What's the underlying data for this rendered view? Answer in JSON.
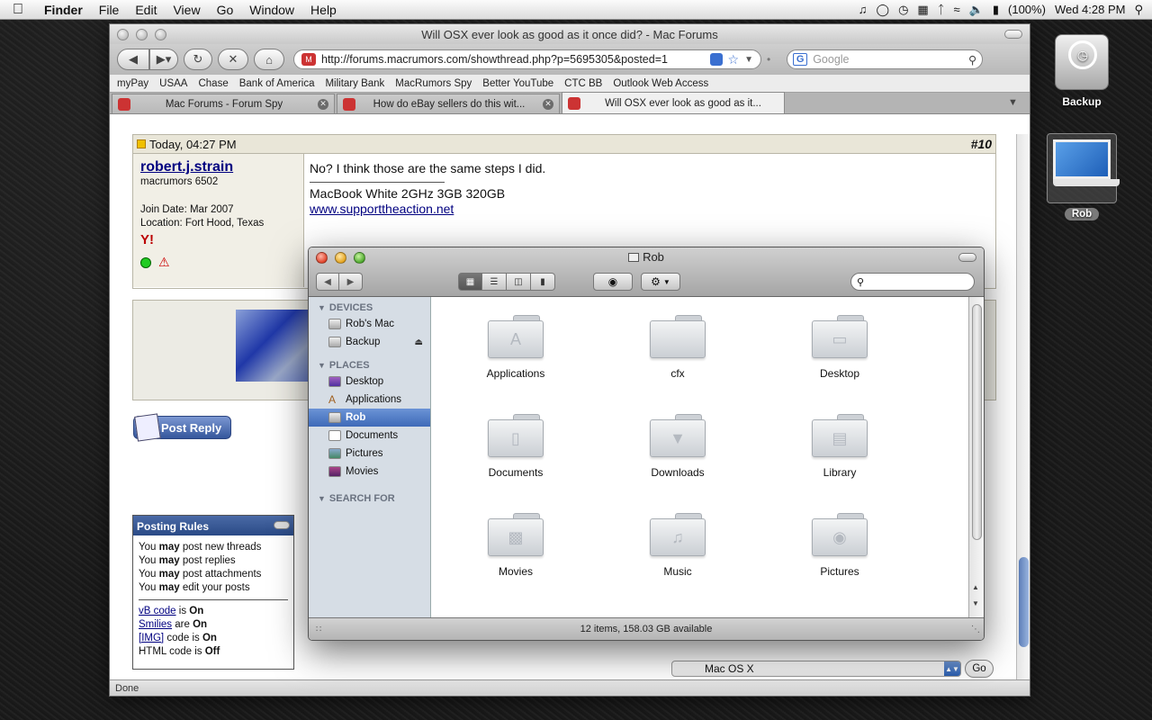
{
  "menubar": {
    "app": "Finder",
    "menus": [
      "File",
      "Edit",
      "View",
      "Go",
      "Window",
      "Help"
    ],
    "battery": "(100%)",
    "clock": "Wed 4:28 PM"
  },
  "browser": {
    "title": "Will OSX ever look as good as it once did? - Mac Forums",
    "url": "http://forums.macrumors.com/showthread.php?p=5695305&posted=1",
    "search_placeholder": "Google",
    "bookmarks": [
      "myPay",
      "USAA",
      "Chase",
      "Bank of America",
      "Military Bank",
      "MacRumors Spy",
      "Better YouTube",
      "CTC BB",
      "Outlook Web Access"
    ],
    "tabs": [
      {
        "label": "Mac Forums - Forum Spy"
      },
      {
        "label": "How do eBay sellers do this wit..."
      },
      {
        "label": "Will OSX ever look as good as it..."
      }
    ],
    "status": "Done"
  },
  "post": {
    "date": "Today, 04:27 PM",
    "number": "#10",
    "username": "robert.j.strain",
    "rank": "macrumors 6502",
    "join_date": "Join Date: Mar 2007",
    "location": "Location: Fort Hood, Texas",
    "message": "No? I think those are the same steps I did.",
    "signature": "MacBook White 2GHz 3GB 320GB",
    "link": "www.supporttheaction.net",
    "reply_button": "Post Reply"
  },
  "rules": {
    "title": "Posting Rules",
    "lines": [
      {
        "pre": "You ",
        "b": "may",
        "post": " post new threads"
      },
      {
        "pre": "You ",
        "b": "may",
        "post": " post replies"
      },
      {
        "pre": "You ",
        "b": "may",
        "post": " post attachments"
      },
      {
        "pre": "You ",
        "b": "may",
        "post": " edit your posts"
      }
    ],
    "codes": [
      {
        "link": "vB code",
        "mid": " is ",
        "b": "On"
      },
      {
        "link": "Smilies",
        "mid": " are ",
        "b": "On"
      },
      {
        "link": "[IMG]",
        "mid": " code is ",
        "b": "On"
      },
      {
        "link": "",
        "mid": "HTML code is ",
        "b": "Off"
      }
    ]
  },
  "forum_jump": {
    "selected": "Mac OS X",
    "go": "Go"
  },
  "finder": {
    "title": "Rob",
    "sections": {
      "devices": "DEVICES",
      "places": "PLACES",
      "search": "SEARCH FOR"
    },
    "devices": [
      "Rob's Mac",
      "Backup"
    ],
    "places": [
      "Desktop",
      "Applications",
      "Rob",
      "Documents",
      "Pictures",
      "Movies"
    ],
    "items": [
      "Applications",
      "cfx",
      "Desktop",
      "Documents",
      "Downloads",
      "Library",
      "Movies",
      "Music",
      "Pictures"
    ],
    "status": "12 items, 158.03 GB available"
  },
  "desktop": {
    "icons": [
      "Backup",
      "Rob"
    ]
  }
}
